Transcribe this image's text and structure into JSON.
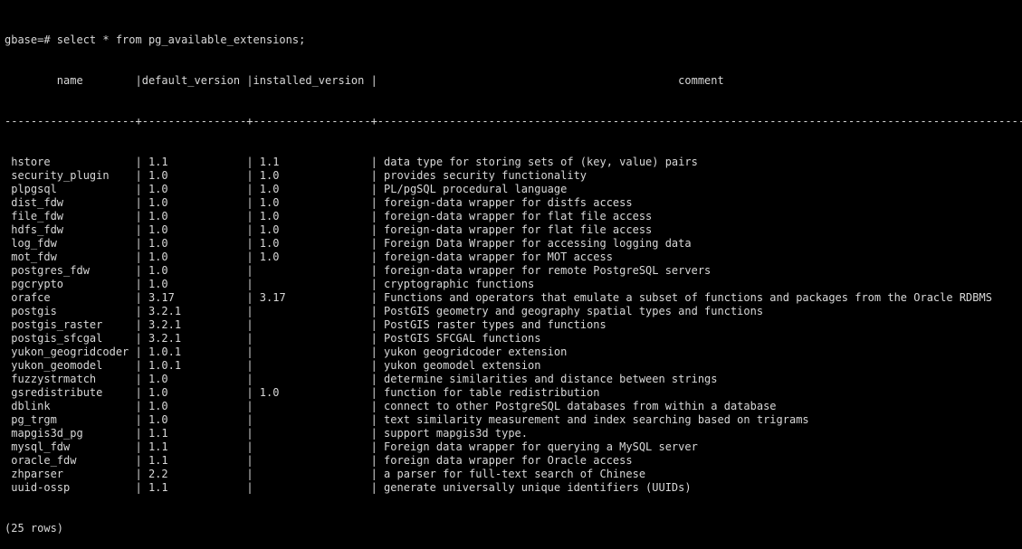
{
  "terminal": {
    "prompt": "gbase=# ",
    "command": "select * from pg_available_extensions;",
    "columns": [
      "name",
      "default_version",
      "installed_version",
      "comment"
    ],
    "rows": [
      [
        "hstore",
        "1.1",
        "1.1",
        "data type for storing sets of (key, value) pairs"
      ],
      [
        "security_plugin",
        "1.0",
        "1.0",
        "provides security functionality"
      ],
      [
        "plpgsql",
        "1.0",
        "1.0",
        "PL/pgSQL procedural language"
      ],
      [
        "dist_fdw",
        "1.0",
        "1.0",
        "foreign-data wrapper for distfs access"
      ],
      [
        "file_fdw",
        "1.0",
        "1.0",
        "foreign-data wrapper for flat file access"
      ],
      [
        "hdfs_fdw",
        "1.0",
        "1.0",
        "foreign-data wrapper for flat file access"
      ],
      [
        "log_fdw",
        "1.0",
        "1.0",
        "Foreign Data Wrapper for accessing logging data"
      ],
      [
        "mot_fdw",
        "1.0",
        "1.0",
        "foreign-data wrapper for MOT access"
      ],
      [
        "postgres_fdw",
        "1.0",
        "",
        "foreign-data wrapper for remote PostgreSQL servers"
      ],
      [
        "pgcrypto",
        "1.0",
        "",
        "cryptographic functions"
      ],
      [
        "orafce",
        "3.17",
        "3.17",
        "Functions and operators that emulate a subset of functions and packages from the Oracle RDBMS"
      ],
      [
        "postgis",
        "3.2.1",
        "",
        "PostGIS geometry and geography spatial types and functions"
      ],
      [
        "postgis_raster",
        "3.2.1",
        "",
        "PostGIS raster types and functions"
      ],
      [
        "postgis_sfcgal",
        "3.2.1",
        "",
        "PostGIS SFCGAL functions"
      ],
      [
        "yukon_geogridcoder",
        "1.0.1",
        "",
        "yukon geogridcoder extension"
      ],
      [
        "yukon_geomodel",
        "1.0.1",
        "",
        "yukon geomodel extension"
      ],
      [
        "fuzzystrmatch",
        "1.0",
        "",
        "determine similarities and distance between strings"
      ],
      [
        "gsredistribute",
        "1.0",
        "1.0",
        "function for table redistribution"
      ],
      [
        "dblink",
        "1.0",
        "",
        "connect to other PostgreSQL databases from within a database"
      ],
      [
        "pg_trgm",
        "1.0",
        "",
        "text similarity measurement and index searching based on trigrams"
      ],
      [
        "mapgis3d_pg",
        "1.1",
        "",
        "support mapgis3d type."
      ],
      [
        "mysql_fdw",
        "1.1",
        "",
        "Foreign data wrapper for querying a MySQL server"
      ],
      [
        "oracle_fdw",
        "1.1",
        "",
        "foreign data wrapper for Oracle access"
      ],
      [
        "zhparser",
        "2.2",
        "",
        "a parser for full-text search of Chinese"
      ],
      [
        "uuid-ossp",
        "1.1",
        "",
        "generate universally unique identifiers (UUIDs)"
      ]
    ],
    "footer": "(25 rows)",
    "colors": {
      "background": "#000000",
      "text": "#d8d8d8"
    }
  }
}
